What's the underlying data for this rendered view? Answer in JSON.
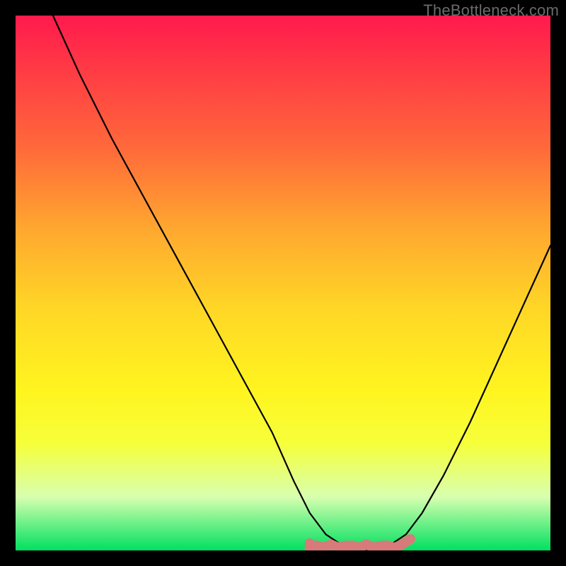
{
  "watermark_text": "TheBottleneck.com",
  "gradient_stops": [
    {
      "offset": 0,
      "color": "#ff1a4d"
    },
    {
      "offset": 10,
      "color": "#ff3a45"
    },
    {
      "offset": 25,
      "color": "#ff6a3a"
    },
    {
      "offset": 40,
      "color": "#ffa82f"
    },
    {
      "offset": 55,
      "color": "#ffd726"
    },
    {
      "offset": 70,
      "color": "#fff41f"
    },
    {
      "offset": 80,
      "color": "#f6ff3a"
    },
    {
      "offset": 90,
      "color": "#d8ffb0"
    },
    {
      "offset": 100,
      "color": "#00e060"
    }
  ],
  "chart_data": {
    "type": "line",
    "title": "",
    "xlabel": "",
    "ylabel": "",
    "xlim": [
      0,
      100
    ],
    "ylim": [
      0,
      100
    ],
    "grid": false,
    "series": [
      {
        "name": "bottleneck-curve",
        "color": "#000000",
        "x": [
          7,
          12,
          18,
          24,
          30,
          36,
          42,
          48,
          52,
          55,
          58,
          61,
          64,
          67,
          70,
          73,
          76,
          80,
          85,
          90,
          95,
          100
        ],
        "y": [
          100,
          89,
          77,
          66,
          55,
          44,
          33,
          22,
          13,
          7,
          3,
          1,
          0,
          0,
          1,
          3,
          7,
          14,
          24,
          35,
          46,
          57
        ]
      }
    ],
    "highlight": {
      "name": "optimal-zone",
      "color": "#d77a7a",
      "x_range": [
        55,
        73
      ],
      "y_level": 0
    }
  }
}
